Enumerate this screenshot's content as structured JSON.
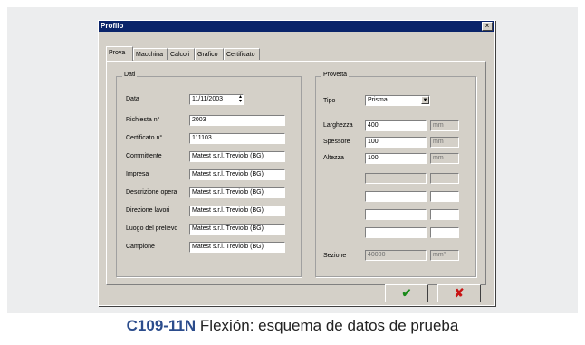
{
  "window": {
    "title": "Profilo",
    "close_label": "×"
  },
  "tabs": [
    {
      "label": "Prova",
      "active": true
    },
    {
      "label": "Macchina",
      "active": false
    },
    {
      "label": "Calcoli",
      "active": false
    },
    {
      "label": "Grafico",
      "active": false
    },
    {
      "label": "Certificato",
      "active": false
    }
  ],
  "dati": {
    "title": "Dati",
    "rows": [
      {
        "label": "Data",
        "value": "11/11/2003"
      },
      {
        "label": "Richiesta n°",
        "value": "2003"
      },
      {
        "label": "Certificato n°",
        "value": "111103"
      },
      {
        "label": "Committente",
        "value": "Matest s.r.l. Treviolo (BG)"
      },
      {
        "label": "Impresa",
        "value": "Matest s.r.l. Treviolo (BG)"
      },
      {
        "label": "Descrizione opera",
        "value": "Matest s.r.l. Treviolo (BG)"
      },
      {
        "label": "Direzione lavori",
        "value": "Matest s.r.l. Treviolo (BG)"
      },
      {
        "label": "Luogo del prelievo",
        "value": "Matest s.r.l. Treviolo (BG)"
      },
      {
        "label": "Campione",
        "value": "Matest s.r.l. Treviolo (BG)"
      }
    ]
  },
  "provetta": {
    "title": "Provetta",
    "tipo_label": "Tipo",
    "tipo_value": "Prisma",
    "larghezza": {
      "label": "Larghezza",
      "value": "400",
      "unit": "mm"
    },
    "spessore": {
      "label": "Spessore",
      "value": "100",
      "unit": "mm"
    },
    "altezza": {
      "label": "Altezza",
      "value": "100",
      "unit": "mm"
    },
    "sezione": {
      "label": "Sezione",
      "value": "40000",
      "unit": "mm²"
    }
  },
  "buttons": {
    "ok": "✔",
    "cancel": "✘",
    "ok_color": "#1a8a1a",
    "cancel_color": "#c81414"
  },
  "caption": {
    "code": "C109-11N",
    "text": " Flexión: esquema de datos de prueba"
  }
}
